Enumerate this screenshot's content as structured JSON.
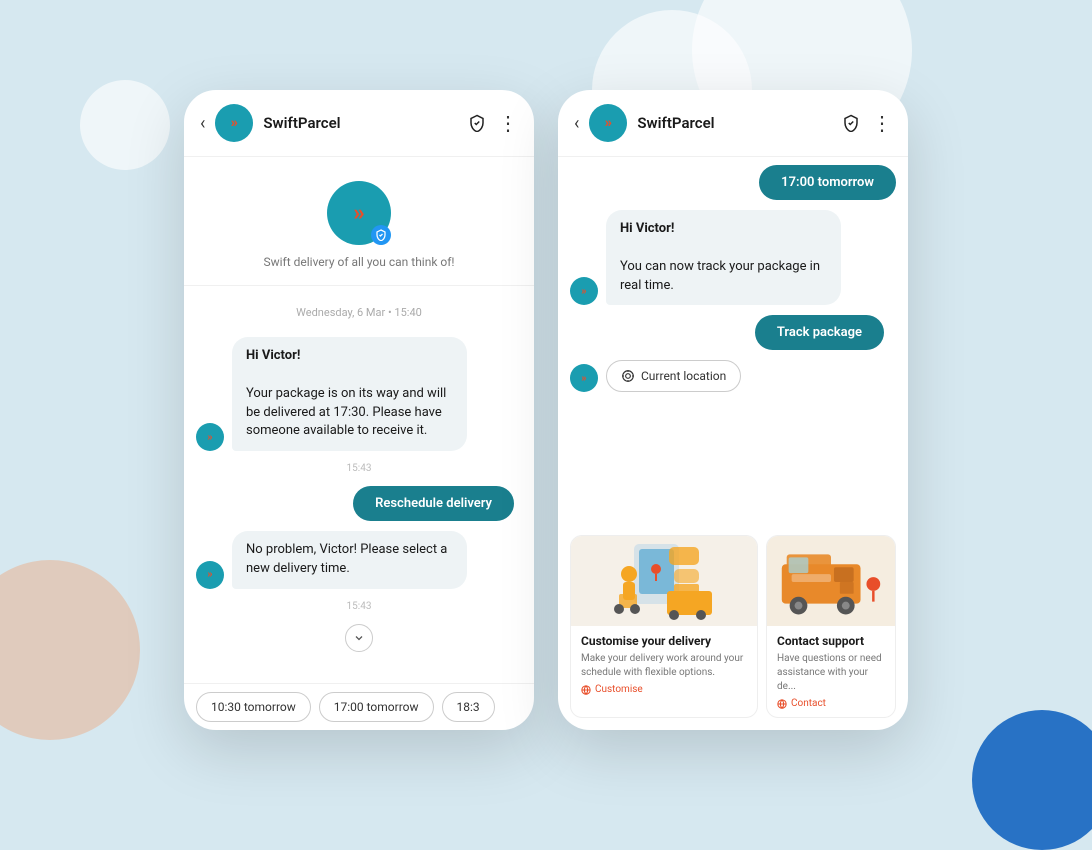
{
  "app": {
    "name": "SwiftParcel",
    "tagline": "Swift delivery of all you can think of!"
  },
  "phone1": {
    "header": {
      "back_label": "‹",
      "app_name": "SwiftParcel",
      "dots": "⋮"
    },
    "profile": {
      "tagline": "Swift delivery of all you can think of!"
    },
    "timestamp_header": "Wednesday, 6 Mar • 15:40",
    "messages": [
      {
        "type": "incoming",
        "text": "Hi Victor!\n\nYour package is on its way and will be delivered at 17:30. Please have someone available to receive it."
      }
    ],
    "timestamp_mid": "15:43",
    "action_button": "Reschedule delivery",
    "messages2": [
      {
        "type": "incoming",
        "text": "No problem, Victor! Please select a new delivery time."
      }
    ],
    "timestamp_mid2": "15:43",
    "time_pills": [
      "10:30 tomorrow",
      "17:00 tomorrow",
      "18:3"
    ]
  },
  "phone2": {
    "header": {
      "back_label": "‹",
      "app_name": "SwiftParcel",
      "dots": "⋮"
    },
    "messages": [
      {
        "type": "outgoing",
        "text": "17:00 tomorrow"
      },
      {
        "type": "incoming",
        "title": "Hi Victor!",
        "text": "You can now track your package in real time."
      }
    ],
    "track_button": "Track package",
    "location_button": "Current location",
    "cards": [
      {
        "title": "Customise your delivery",
        "desc": "Make your delivery work around your schedule with flexible options.",
        "link": "Customise",
        "bg": "delivery"
      },
      {
        "title": "Contact support",
        "desc": "Have questions or need assistance with your de...",
        "link": "Contact",
        "bg": "truck"
      }
    ]
  },
  "icons": {
    "chevrons": "»",
    "location": "◎",
    "globe": "🌐"
  }
}
